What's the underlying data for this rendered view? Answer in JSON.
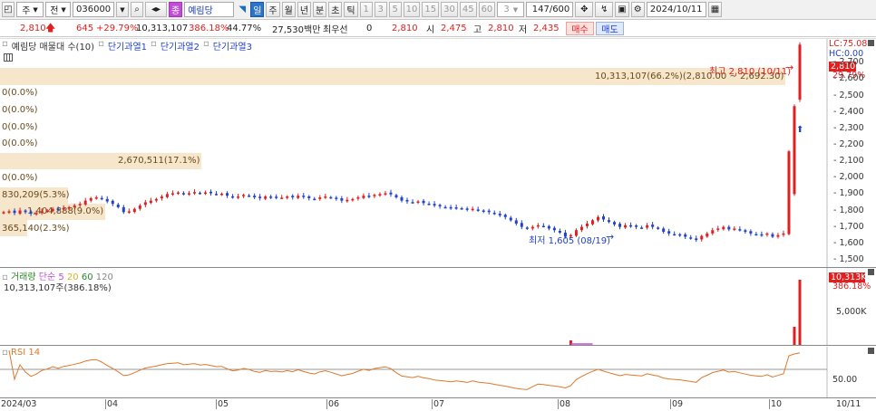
{
  "toolbar": {
    "mode_label": "주",
    "market_label": "전",
    "code_value": "036000",
    "stock_name": "예림당",
    "stock_badge": "종",
    "period_buttons": [
      "일",
      "주",
      "월",
      "년",
      "분",
      "초",
      "틱"
    ],
    "interval_buttons": [
      "1",
      "3",
      "5",
      "10",
      "15",
      "30",
      "45",
      "60"
    ],
    "interval_value": "3",
    "count_value": "147",
    "count_max": "/600",
    "date_value": "2024/10/11"
  },
  "quote": {
    "price": "2,810",
    "change": "645",
    "change_pct": "+29.79%",
    "volume": "10,313,107",
    "volume_ratio": "386.18%",
    "turnover": "44.77%",
    "amount": "27,530백만",
    "priority_label": "최우선",
    "priority_value": "0",
    "last": "2,810",
    "open_label": "시",
    "open": "2,475",
    "high_label": "고",
    "high": "2,810",
    "low_label": "저",
    "low": "2,435",
    "buy_label": "매수",
    "sell_label": "매도"
  },
  "price_panel": {
    "legend": [
      "예림당 매물대 수(10)",
      "단기과열1",
      "단기과열2",
      "단기과열3"
    ],
    "high_marker": "최고 2,810 (10/11)",
    "low_marker": "최저 1,605 (08/19)",
    "lc_label": "LC:75.08",
    "hc_label": "HC:0.00",
    "current_price_tag": "2,810",
    "current_pct_tag": "29.79%",
    "y_ticks": [
      "2,700",
      "2,600",
      "2,500",
      "2,400",
      "2,300",
      "2,200",
      "2,100",
      "2,000",
      "1,900",
      "1,800",
      "1,700",
      "1,600",
      "1,500"
    ],
    "volume_profile": [
      {
        "label": "10,313,107(66.2%)(2,810.00 ~ 2,692.30)"
      },
      {
        "label": "0(0.0%)"
      },
      {
        "label": "0(0.0%)"
      },
      {
        "label": "0(0.0%)"
      },
      {
        "label": "0(0.0%)"
      },
      {
        "label": "2,670,511(17.1%)"
      },
      {
        "label": "0(0.0%)"
      },
      {
        "label": "830,209(5.3%)"
      },
      {
        "label": "1,404,888(9.0%)"
      },
      {
        "label": "365,140(2.3%)"
      }
    ]
  },
  "volume_panel": {
    "legend_name": "거래량",
    "legend_ma": "단순",
    "ma_periods": [
      "5",
      "20",
      "60",
      "120"
    ],
    "value_text": "10,313,107주(386.18%)",
    "tag_value": "10,313K",
    "tag_pct": "386.18%",
    "y_tick": "5,000K"
  },
  "rsi_panel": {
    "legend": "RSI 14",
    "y_tick": "50.00"
  },
  "x_axis": {
    "labels": [
      "2024/03",
      "04",
      "05",
      "06",
      "07",
      "08",
      "09",
      "10"
    ],
    "right_label": "10/11"
  },
  "colors": {
    "up": "#e02020",
    "down": "#2142c9",
    "band": "#f6e6cc",
    "rsi": "#e0782a"
  },
  "chart_data": {
    "type": "candlestick",
    "title": "예림당",
    "ylim": [
      1450,
      2850
    ],
    "x_axis_months": [
      "2024/03",
      "04",
      "05",
      "06",
      "07",
      "08",
      "09",
      "10"
    ],
    "closes": [
      1790,
      1795,
      1785,
      1800,
      1790,
      1780,
      1785,
      1795,
      1800,
      1810,
      1805,
      1815,
      1820,
      1830,
      1840,
      1860,
      1875,
      1880,
      1870,
      1855,
      1840,
      1820,
      1790,
      1795,
      1810,
      1830,
      1850,
      1860,
      1870,
      1885,
      1900,
      1905,
      1910,
      1900,
      1905,
      1912,
      1905,
      1910,
      1905,
      1900,
      1902,
      1890,
      1880,
      1885,
      1895,
      1890,
      1880,
      1875,
      1885,
      1880,
      1882,
      1878,
      1885,
      1880,
      1890,
      1882,
      1875,
      1870,
      1880,
      1885,
      1878,
      1870,
      1860,
      1865,
      1870,
      1880,
      1890,
      1885,
      1895,
      1900,
      1905,
      1898,
      1880,
      1860,
      1855,
      1850,
      1855,
      1845,
      1840,
      1830,
      1825,
      1820,
      1815,
      1818,
      1812,
      1805,
      1810,
      1800,
      1795,
      1790,
      1780,
      1770,
      1760,
      1740,
      1720,
      1700,
      1690,
      1700,
      1710,
      1705,
      1690,
      1680,
      1665,
      1640,
      1650,
      1680,
      1700,
      1720,
      1740,
      1760,
      1745,
      1730,
      1715,
      1700,
      1710,
      1705,
      1700,
      1695,
      1710,
      1700,
      1690,
      1670,
      1660,
      1655,
      1650,
      1640,
      1630,
      1620,
      1645,
      1660,
      1680,
      1690,
      1700,
      1685,
      1690,
      1680,
      1670,
      1660,
      1655,
      1650,
      1660,
      1640,
      1650,
      1660,
      2160,
      2435,
      2810
    ],
    "high": 2810,
    "high_date": "10/11",
    "low": 1605,
    "low_date": "08/19",
    "last_volume": 10313107,
    "rsi_period": 14,
    "rsi_reference": 50
  }
}
